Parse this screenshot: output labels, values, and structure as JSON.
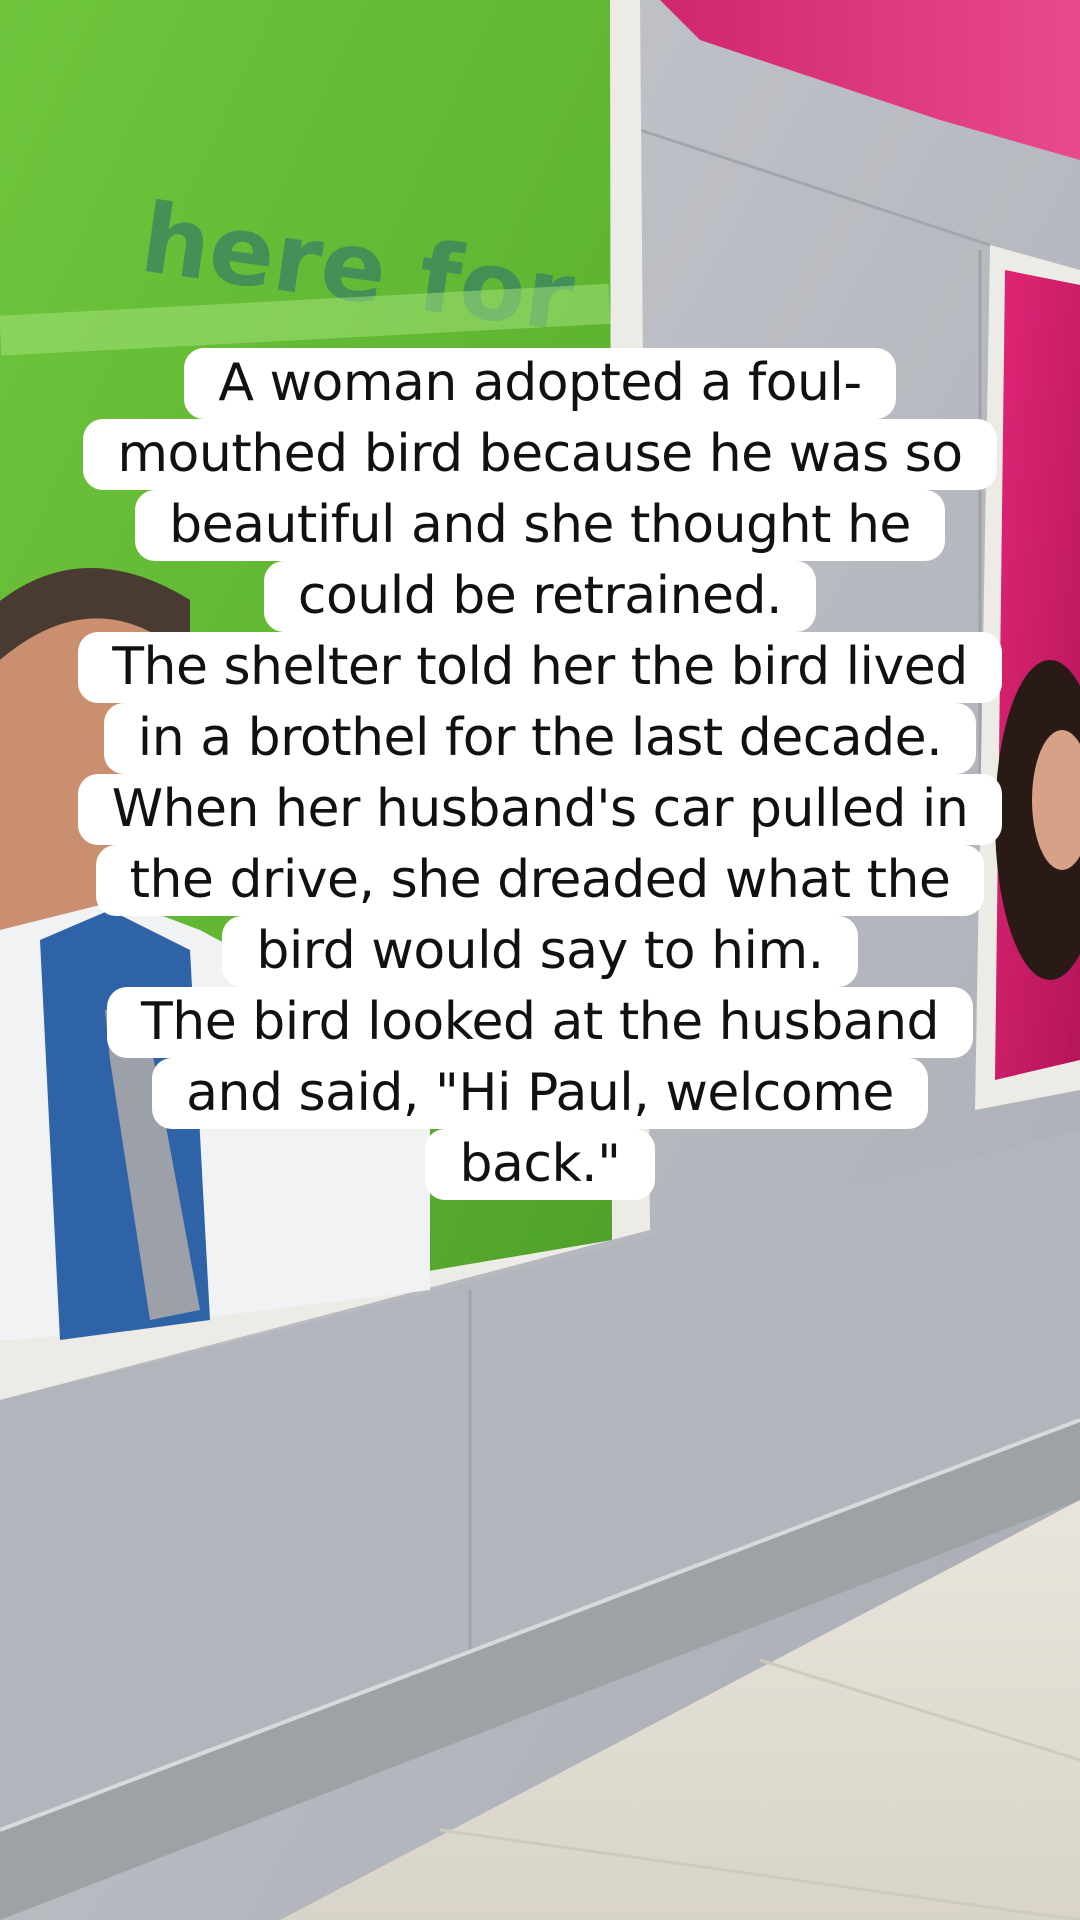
{
  "background": {
    "sign_text": "here for",
    "colors": {
      "green_panel": "#6bc33b",
      "pink_panel": "#d01e6a",
      "wall": "#b9bcc3",
      "floor": "#e8e4da",
      "frame": "#ecebe6"
    }
  },
  "caption": {
    "lines": [
      "A woman adopted a foul-",
      "mouthed bird because he was so",
      "beautiful and she thought he",
      "could be retrained.",
      "The shelter told her the bird lived",
      "in a brothel for the last decade.",
      "When her husband's car pulled in",
      "the drive, she dreaded what the",
      "bird would say to him.",
      "The bird looked at the husband",
      "and said, \"Hi Paul, welcome",
      "back.\""
    ]
  }
}
